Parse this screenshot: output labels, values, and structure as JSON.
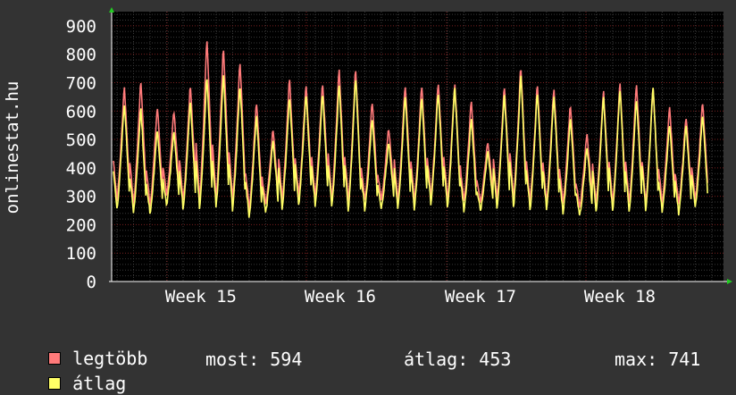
{
  "chart_data": {
    "type": "line",
    "ylabel": "onlinestat.hu",
    "ylim": [
      0,
      950
    ],
    "yticks": [
      0,
      100,
      200,
      300,
      400,
      500,
      600,
      700,
      800,
      900
    ],
    "x_range": [
      "Week 14",
      "Week 18"
    ],
    "xticks": [
      "Week 15",
      "Week 16",
      "Week 17",
      "Week 18"
    ],
    "grid": true,
    "daily_peaks_legtobb": [
      695,
      715,
      620,
      605,
      700,
      865,
      830,
      780,
      640,
      540,
      720,
      700,
      710,
      760,
      755,
      640,
      545,
      700,
      700,
      710,
      705,
      640,
      500,
      690,
      765,
      700,
      690,
      630,
      525,
      680,
      710,
      705,
      690,
      620,
      590,
      635
    ],
    "daily_peaks_atlag": [
      635,
      615,
      540,
      530,
      640,
      730,
      735,
      700,
      590,
      500,
      660,
      670,
      670,
      700,
      730,
      580,
      495,
      660,
      660,
      675,
      690,
      580,
      460,
      665,
      735,
      675,
      665,
      580,
      480,
      660,
      690,
      655,
      695,
      560,
      560,
      595
    ],
    "daily_lows_atlag": [
      250,
      235,
      235,
      265,
      250,
      255,
      260,
      250,
      220,
      240,
      255,
      265,
      260,
      255,
      245,
      250,
      255,
      250,
      250,
      265,
      255,
      245,
      250,
      255,
      255,
      245,
      245,
      240,
      225,
      240,
      240,
      240,
      245,
      240,
      235,
      255
    ],
    "series": [
      {
        "name": "legtöbb",
        "color": "#ff7a7a"
      },
      {
        "name": "átlag",
        "color": "#ffff66"
      }
    ],
    "legend_position": "bottom-left"
  },
  "legend": {
    "max_label": "legtöbb",
    "avg_label": "átlag",
    "stat_now": "most: 594",
    "stat_avg": "átlag: 453",
    "stat_max": "max: 741"
  }
}
